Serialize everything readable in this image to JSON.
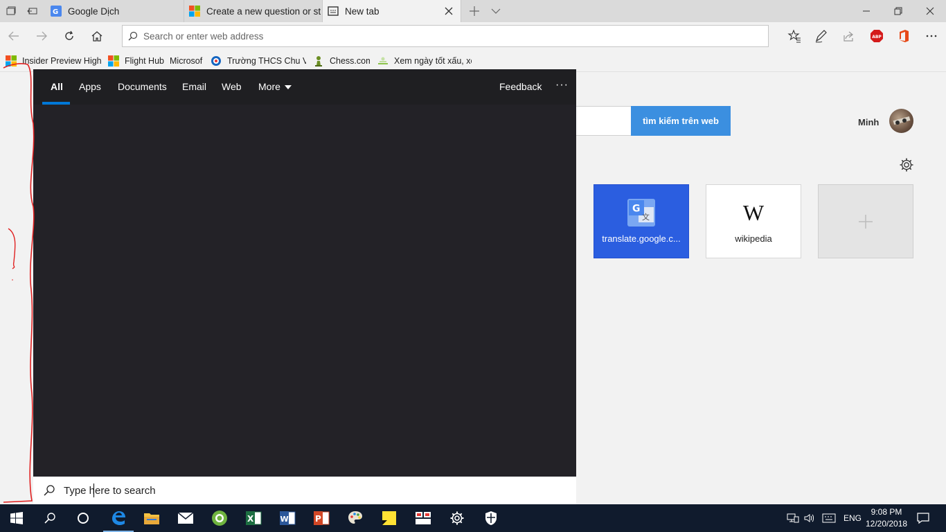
{
  "browser": {
    "tabs": [
      {
        "title": "Google Dịch",
        "icon": "google-translate-icon"
      },
      {
        "title": "Create a new question or st",
        "icon": "microsoft-icon"
      },
      {
        "title": "New tab",
        "icon": "newtab-icon",
        "active": true
      }
    ],
    "address_placeholder": "Search or enter web address",
    "favorites": [
      {
        "label": "Insider Preview Highl",
        "icon": "microsoft-icon"
      },
      {
        "label": "Flight Hub",
        "icon": "microsoft-icon"
      },
      {
        "label": "Microsof",
        "icon": ""
      },
      {
        "label": "Trường THCS Chu Văi",
        "icon": "school-icon"
      },
      {
        "label": "Chess.com",
        "icon": "chess-pawn-icon"
      },
      {
        "label": "Xem ngày tốt xấu, xe",
        "icon": "calendar-icon"
      }
    ]
  },
  "newtab": {
    "search_button": "tìm kiếm trên web",
    "user_name": "Minh",
    "tiles": [
      {
        "label": "translate.google.c...",
        "icon": "google-translate-icon"
      },
      {
        "label": "wikipedia",
        "icon": "wikipedia-icon"
      },
      {
        "label": "",
        "icon": "plus-icon"
      }
    ]
  },
  "search_panel": {
    "tabs": [
      "All",
      "Apps",
      "Documents",
      "Email",
      "Web",
      "More"
    ],
    "active_tab": "All",
    "feedback": "Feedback",
    "more_options": "···",
    "search_placeholder": "Type here to search"
  },
  "taskbar": {
    "language": "ENG",
    "time": "9:08 PM",
    "date": "12/20/2018",
    "accent_color": "#0078d7"
  }
}
